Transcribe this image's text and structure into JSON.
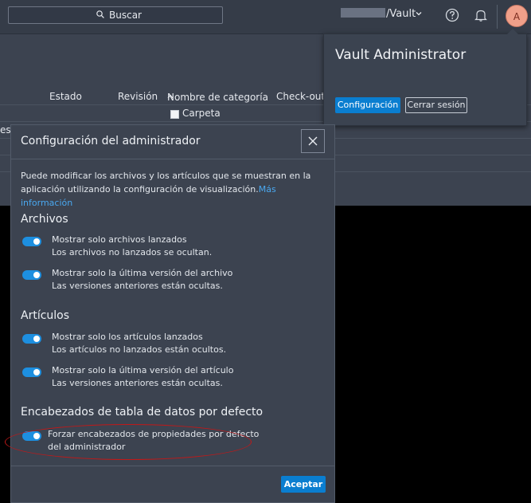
{
  "topbar": {
    "search_label": "Buscar",
    "vault_name": "/Vault",
    "avatar_initial": "A"
  },
  "grid": {
    "columns": [
      "Estado",
      "Revisión",
      "Nombre de categoría",
      "Check-out ap"
    ],
    "row_folder": "Carpeta",
    "row_fragment": "es"
  },
  "user_popover": {
    "name": "Vault Administrator",
    "settings_label": "Configuración",
    "logout_label": "Cerrar sesión"
  },
  "dialog": {
    "title": "Configuración del administrador",
    "intro_text": "Puede modificar los archivos y los artículos que se muestran en la aplicación utilizando la configuración de visualización.",
    "intro_link": "Más información",
    "sections": [
      {
        "heading": "Archivos",
        "options": [
          {
            "label": "Mostrar solo archivos lanzados",
            "desc": "Los archivos no lanzados se ocultan.",
            "on": true
          },
          {
            "label": "Mostrar solo la última versión del archivo",
            "desc": "Las versiones anteriores están ocultas.",
            "on": true
          }
        ]
      },
      {
        "heading": "Artículos",
        "options": [
          {
            "label": "Mostrar solo los artículos lanzados",
            "desc": "Los artículos no lanzados están ocultos.",
            "on": true
          },
          {
            "label": "Mostrar solo la última versión del artículo",
            "desc": "Las versiones anteriores están ocultas.",
            "on": true
          }
        ]
      },
      {
        "heading": "Encabezados de tabla de datos por defecto",
        "options": [
          {
            "label": "Forzar encabezados de propiedades por defecto",
            "desc": "del administrador",
            "on": true
          }
        ]
      }
    ],
    "accept_label": "Aceptar"
  },
  "colors": {
    "accent": "#0a7ed0",
    "link": "#4aa8f0",
    "annotation": "#c21818"
  }
}
